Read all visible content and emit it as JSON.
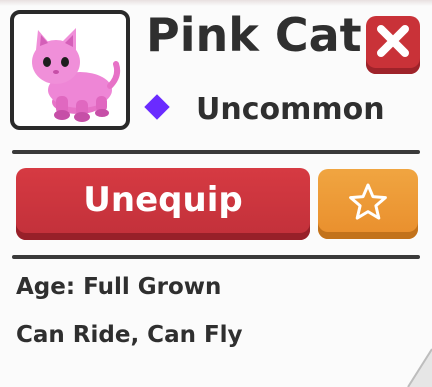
{
  "pet": {
    "name": "Pink Cat",
    "rarity": "Uncommon",
    "rarity_color": "#6a2bff",
    "thumbnail_icon": "pink-cat-icon"
  },
  "actions": {
    "equip_label": "Unequip",
    "favorite_icon": "star-icon",
    "close_icon": "close-icon"
  },
  "info": {
    "age": "Age: Full Grown",
    "abilities": "Can Ride, Can Fly"
  },
  "colors": {
    "close_button": "#c93238",
    "equip_button": "#c93238",
    "favorite_button": "#eb9434",
    "text": "#2f2f2f"
  }
}
